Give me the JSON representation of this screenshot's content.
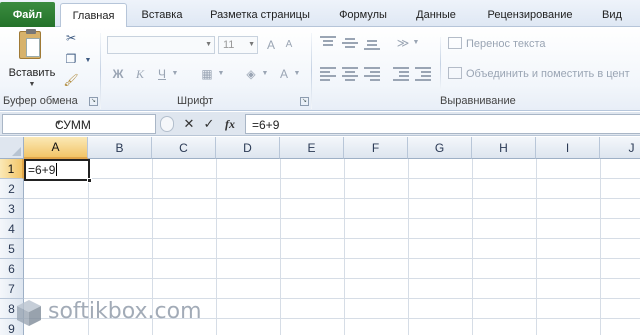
{
  "ribbon_tabs": {
    "file": "Файл",
    "home": "Главная",
    "insert": "Вставка",
    "page_layout": "Разметка страницы",
    "formulas": "Формулы",
    "data": "Данные",
    "review": "Рецензирование",
    "view": "Вид"
  },
  "clipboard": {
    "paste_label": "Вставить",
    "group_label": "Буфер обмена",
    "icons": [
      "scissors-icon",
      "copy-icon",
      "format-painter-icon",
      "paste-icon"
    ]
  },
  "font": {
    "group_label": "Шрифт",
    "font_name": "",
    "font_size": "11",
    "bold": "Ж",
    "italic": "К",
    "underline": "Ч",
    "grow": "A",
    "shrink": "A",
    "color_a": "A"
  },
  "alignment": {
    "group_label": "Выравнивание",
    "wrap_text": "Перенос текста",
    "merge_center": "Объединить и поместить в цент"
  },
  "formula_bar": {
    "name_box": "СУММ",
    "cancel": "✕",
    "enter": "✓",
    "fx": "fx",
    "formula": "=6+9"
  },
  "sheet": {
    "columns": [
      "A",
      "B",
      "C",
      "D",
      "E",
      "F",
      "G",
      "H",
      "I",
      "J"
    ],
    "rows": [
      "1",
      "2",
      "3",
      "4",
      "5",
      "6",
      "7",
      "8",
      "9"
    ],
    "active_cell": "A1",
    "active_cell_value": "=6+9"
  },
  "colors": {
    "file_tab": "#2e7d32",
    "selected_header": "#f2c568"
  },
  "watermark": "softikbox.com"
}
